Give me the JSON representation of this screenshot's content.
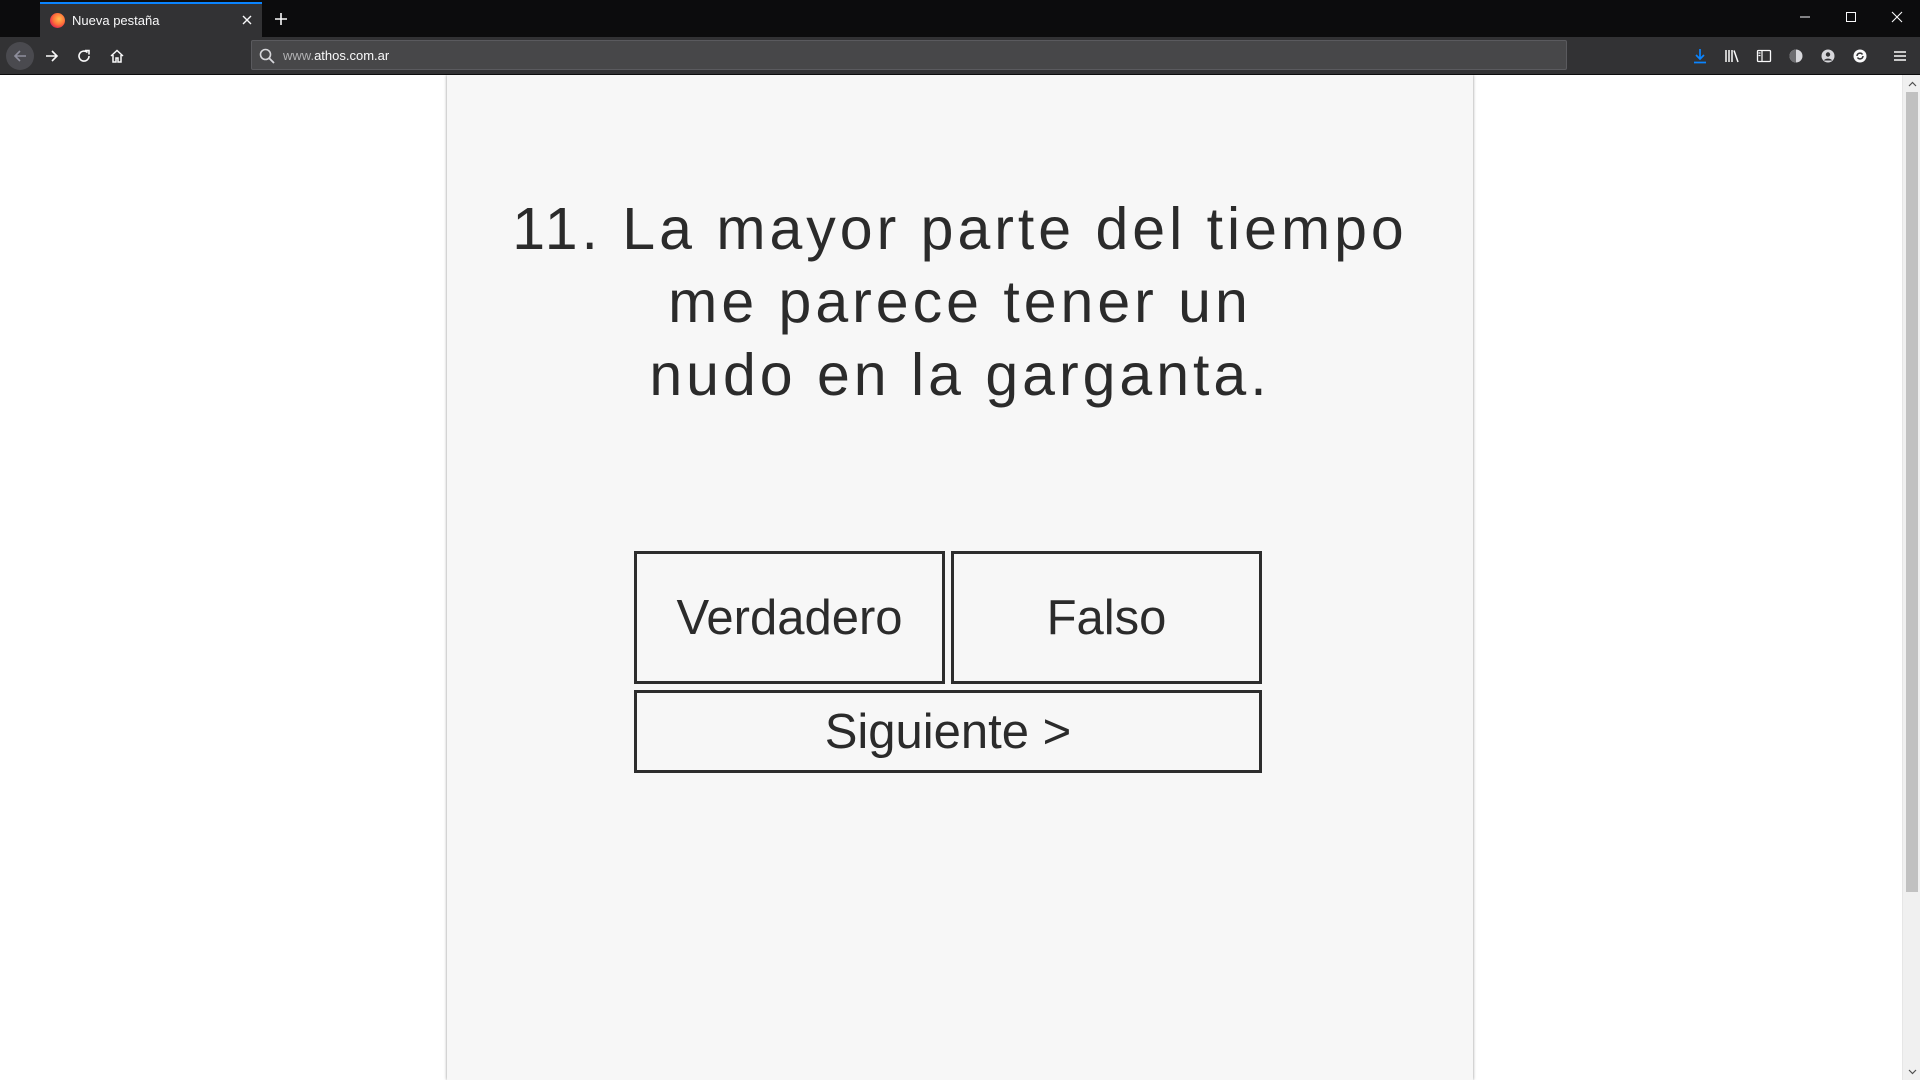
{
  "browser": {
    "tab": {
      "title": "Nueva pestaña"
    },
    "url": {
      "prefix": "www.",
      "domain": "athos.com.ar"
    },
    "accent_color": "#0a84ff",
    "toolbar_icons": [
      "download-icon",
      "library-icon",
      "sidebar-icon",
      "extension-icon",
      "account-icon",
      "sync-icon",
      "menu-icon"
    ]
  },
  "page": {
    "question": "11. La mayor parte del tiempo\nme parece tener un\nnudo en la garganta.",
    "buttons": {
      "true_label": "Verdadero",
      "false_label": "Falso",
      "next_label": "Siguiente >"
    }
  }
}
